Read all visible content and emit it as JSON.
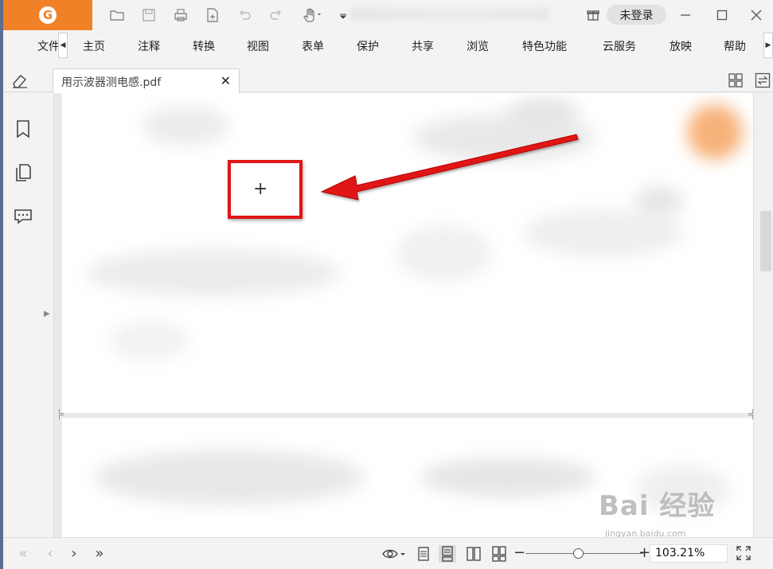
{
  "app": {
    "login_label": "未登录",
    "logo_letter": "G",
    "accent_color": "#f08127"
  },
  "quick_access": [
    "open-folder-icon",
    "save-icon",
    "print-icon",
    "new-doc-icon",
    "undo-icon",
    "redo-icon",
    "hand-tool-icon",
    "customize-icon"
  ],
  "menu": {
    "items": [
      "文件",
      "主页",
      "注释",
      "转换",
      "视图",
      "表单",
      "保护",
      "共享",
      "浏览",
      "特色功能",
      "云服务",
      "放映",
      "帮助"
    ]
  },
  "tabs": {
    "doc_tab_label": "用示波器测电感.pdf",
    "close_glyph": "✕"
  },
  "sidebar": {
    "icons": [
      "bookmark-icon",
      "pages-icon",
      "comments-icon"
    ]
  },
  "annotation": {
    "crosshair_glyph": "+",
    "highlight_color": "#e01515"
  },
  "statusbar": {
    "zoom_value": "103.21%",
    "zoom_level_fraction": 0.45
  },
  "watermark": {
    "main": "Bai 经验",
    "sub": "jingyan.baidu.com"
  }
}
